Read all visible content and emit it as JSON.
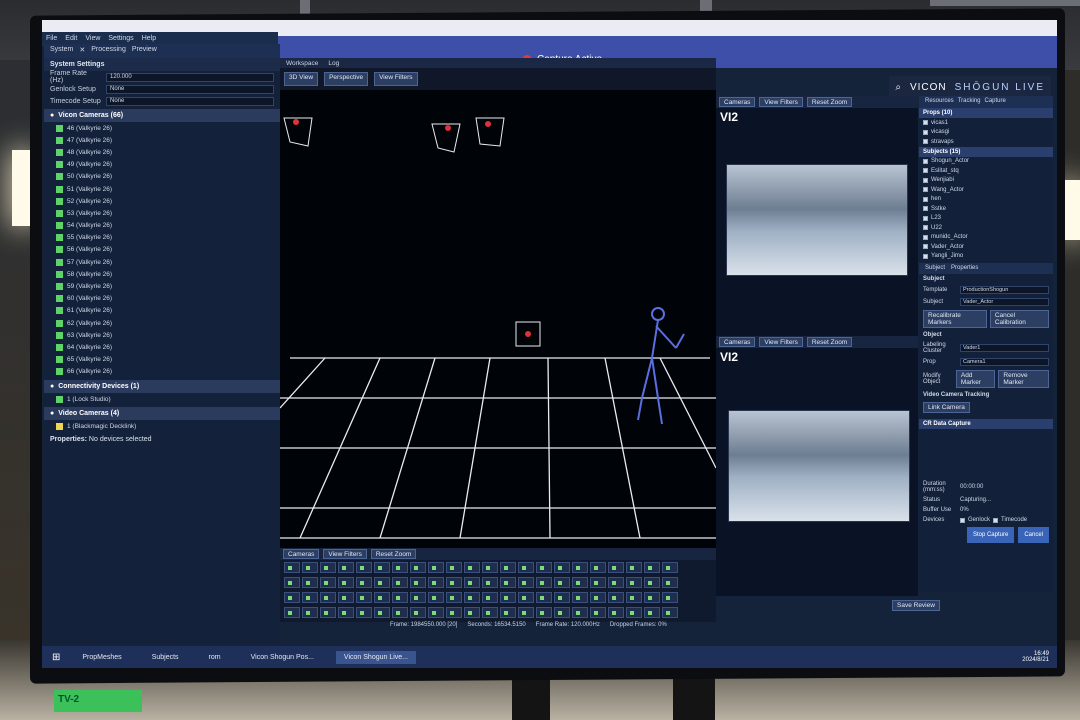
{
  "window": {
    "app_menu": [
      "File",
      "Edit",
      "View",
      "Settings",
      "Help"
    ],
    "capture_status": "Capture Active",
    "brand_left": "VICON",
    "brand_right": "SHŌGUN LIVE"
  },
  "left_panel": {
    "tabs": [
      "System",
      "Processing",
      "Preview"
    ],
    "section": "System Settings",
    "fields": [
      {
        "label": "Frame Rate (Hz)",
        "value": "120.000"
      },
      {
        "label": "Genlock Setup",
        "value": "None"
      },
      {
        "label": "Timecode Setup",
        "value": "None"
      }
    ],
    "cameras_group": "Vicon Cameras (66)",
    "cameras": [
      "46 (Valkyrie 26)",
      "47 (Valkyrie 26)",
      "48 (Valkyrie 26)",
      "49 (Valkyrie 26)",
      "50 (Valkyrie 26)",
      "51 (Valkyrie 26)",
      "52 (Valkyrie 26)",
      "53 (Valkyrie 26)",
      "54 (Valkyrie 26)",
      "55 (Valkyrie 26)",
      "56 (Valkyrie 26)",
      "57 (Valkyrie 26)",
      "58 (Valkyrie 26)",
      "59 (Valkyrie 26)",
      "60 (Valkyrie 26)",
      "61 (Valkyrie 26)",
      "62 (Valkyrie 26)",
      "63 (Valkyrie 26)",
      "64 (Valkyrie 26)",
      "65 (Valkyrie 26)",
      "66 (Valkyrie 26)"
    ],
    "connectivity_group": "Connectivity Devices (1)",
    "connectivity_item": "1 (Lock Studio)",
    "video_group": "Video Cameras (4)",
    "video_item": "1 (Blackmagic Decklink)",
    "properties_label": "Properties:",
    "properties_value": "No devices selected"
  },
  "workspace": {
    "tabs": [
      "Workspace",
      "Log"
    ],
    "view_mode": "3D View",
    "projection": "Perspective",
    "view_filters": "View Filters"
  },
  "video_panels": [
    {
      "label": "Cameras",
      "view_filters": "View Filters",
      "reset_zoom": "Reset Zoom",
      "title": "VI2"
    },
    {
      "label": "Cameras",
      "view_filters": "View Filters",
      "reset_zoom": "Reset Zoom",
      "title": "VI2"
    }
  ],
  "right_panel": {
    "tabs": [
      "Resources",
      "Tracking",
      "Capture"
    ],
    "props_header": "Props (10)",
    "props": [
      "vicas1",
      "vicasgi",
      "stravaps"
    ],
    "subjects_header": "Subjects (15)",
    "subjects": [
      "Shogun_Actor",
      "Eslitat_stq",
      "Wenjiabi",
      "Wang_Actor",
      "hen",
      "Sstke",
      "L23",
      "U22",
      "munidc_Actor",
      "Vader_Actor",
      "Yangli_Jimo"
    ],
    "subtabs": [
      "Subject",
      "Properties"
    ],
    "subject_section": "Subject",
    "template_label": "Template",
    "template_value": "ProductionShogun",
    "subject_label": "Subject",
    "subject_value": "Vader_Actor",
    "recalibrate": "Recalibrate Markers",
    "cancel_calibration": "Cancel Calibration",
    "object_section": "Object",
    "labeling_label": "Labeling Cluster",
    "labeling_value": "Vader1",
    "prop_label": "Prop",
    "prop_value": "Camera1",
    "modify_label": "Modify Object",
    "add_marker": "Add Marker",
    "remove_marker": "Remove Marker",
    "video_tracking": "Video Camera Tracking",
    "link_camera": "Link Camera",
    "data_capture": "CR Data Capture",
    "duration_label": "Duration (mm:ss)",
    "duration_value": "00:00:00",
    "status_label": "Status",
    "status_value": "Capturing...",
    "buffer_label": "Buffer Use",
    "buffer_value": "0%",
    "devices_label": "Devices",
    "devices_values": [
      "Genlock",
      "Timecode"
    ],
    "stop_capture": "Stop Capture",
    "cancel": "Cancel"
  },
  "timeline": {
    "label": "Cameras",
    "view_filters": "View Filters",
    "reset_zoom": "Reset Zoom",
    "frame": "Frame: 1984550.000 [20]",
    "seconds": "Seconds: 16534.5150",
    "frame_rate": "Frame Rate: 120.000Hz",
    "dropped": "Dropped Frames: 0%",
    "save_review": "Save Review"
  },
  "taskbar": {
    "items": [
      "PropMeshes",
      "Subjects",
      "rom",
      "Vicon Shogun Pos...",
      "Vicon Shogun Live..."
    ],
    "active_index": 4,
    "clock_time": "16:49",
    "clock_date": "2024/8/21"
  },
  "sticker": "TV-2"
}
